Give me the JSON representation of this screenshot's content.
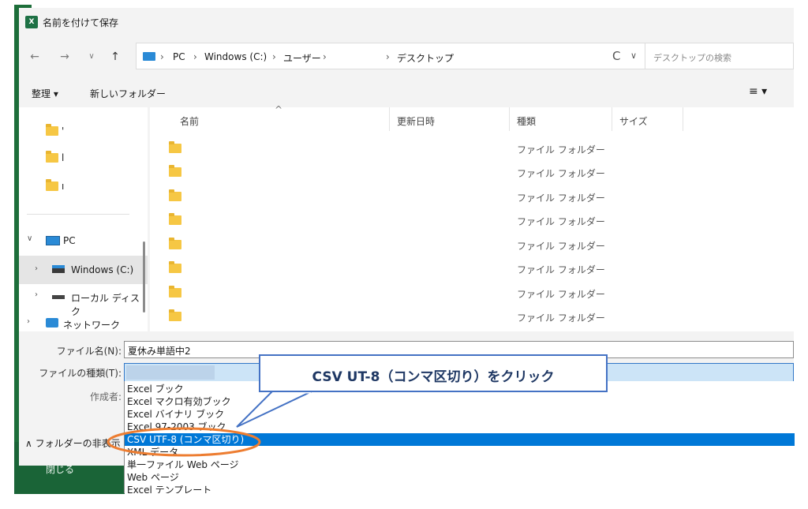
{
  "window": {
    "title": "名前を付けて保存",
    "app_icon": "excel-icon"
  },
  "nav": {
    "back": "←",
    "forward": "→",
    "recent": "∨",
    "up": "↑",
    "refresh": "C",
    "dropdown": "∨"
  },
  "address": {
    "crumbs": [
      "PC",
      "Windows (C:)",
      "ユーザー",
      "デスクトップ"
    ],
    "sep": "›"
  },
  "search": {
    "placeholder": "デスクトップの検索"
  },
  "toolbar": {
    "organize": "整理 ▾",
    "new_folder": "新しいフォルダー",
    "view": "≡ ▾"
  },
  "sidebar": {
    "folders": [
      {
        "label": "'"
      },
      {
        "label": "l"
      },
      {
        "label": "ı"
      }
    ],
    "pc": "PC",
    "drive_c": "Windows (C:)",
    "local_disk": "ローカル ディスク",
    "network": "ネットワーク"
  },
  "columns": {
    "name": "名前",
    "date": "更新日時",
    "type": "種類",
    "size": "サイズ"
  },
  "files": [
    {
      "type": "ファイル フォルダー"
    },
    {
      "type": "ファイル フォルダー"
    },
    {
      "type": "ファイル フォルダー"
    },
    {
      "type": "ファイル フォルダー"
    },
    {
      "type": "ファイル フォルダー"
    },
    {
      "type": "ファイル フォルダー"
    },
    {
      "type": "ファイル フォルダー"
    },
    {
      "type": "ファイル フォルダー"
    }
  ],
  "form": {
    "filename_label": "ファイル名(N):",
    "filename_value": "夏休み単語中2",
    "filetype_label": "ファイルの種類(T):",
    "author_label": "作成者:"
  },
  "hide_folders": "∧ フォルダーの非表示",
  "close_label": "閉じる",
  "filetype_options": [
    "Excel ブック",
    "Excel マクロ有効ブック",
    "Excel バイナリ ブック",
    "Excel 97-2003 ブック",
    "CSV UTF-8 (コンマ区切り)",
    "XML データ",
    "単一ファイル Web ページ",
    "Web ページ",
    "Excel テンプレート"
  ],
  "selected_option": "CSV UTF-8 (コンマ区切り)",
  "annotation": {
    "text": "CSV UT-8（コンマ区切り）をクリック"
  },
  "colors": {
    "accent": "#0078d7",
    "callout_border": "#4472c4",
    "callout_text": "#1f3864",
    "circle": "#ed7d31",
    "excel_green": "#1d6e3a"
  }
}
